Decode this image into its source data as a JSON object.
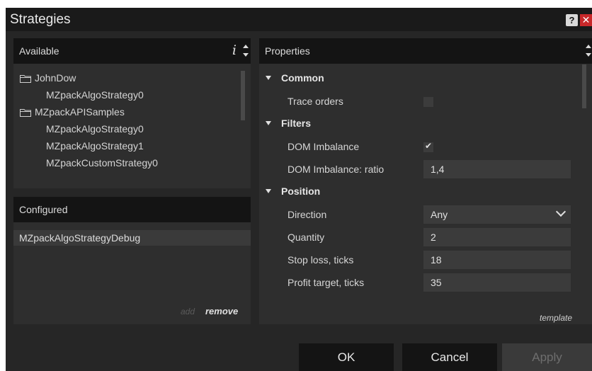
{
  "window": {
    "title": "Strategies",
    "help_label": "?",
    "close_label": "✕"
  },
  "available": {
    "header": "Available",
    "info_label": "i",
    "tree": [
      {
        "label": "JohnDow",
        "type": "folder"
      },
      {
        "label": "MZpackAlgoStrategy0",
        "type": "item"
      },
      {
        "label": "MZpackAPISamples",
        "type": "folder"
      },
      {
        "label": "MZpackAlgoStrategy0",
        "type": "item"
      },
      {
        "label": "MZpackAlgoStrategy1",
        "type": "item"
      },
      {
        "label": "MZpackCustomStrategy0",
        "type": "item"
      }
    ]
  },
  "configured": {
    "header": "Configured",
    "items": [
      "MZpackAlgoStrategyDebug"
    ],
    "add_label": "add",
    "remove_label": "remove"
  },
  "properties": {
    "header": "Properties",
    "categories": {
      "common": "Common",
      "filters": "Filters",
      "position": "Position"
    },
    "trace_orders": {
      "label": "Trace orders",
      "checked": false
    },
    "dom_imbalance": {
      "label": "DOM Imbalance",
      "checked": true,
      "check_glyph": "✔"
    },
    "dom_ratio": {
      "label": "DOM Imbalance: ratio",
      "value": "1,4"
    },
    "direction": {
      "label": "Direction",
      "value": "Any"
    },
    "quantity": {
      "label": "Quantity",
      "value": "2"
    },
    "stop_loss": {
      "label": "Stop loss, ticks",
      "value": "18"
    },
    "profit_target": {
      "label": "Profit target, ticks",
      "value": "35"
    },
    "template_label": "template"
  },
  "buttons": {
    "ok": "OK",
    "cancel": "Cancel",
    "apply": "Apply"
  },
  "colors": {
    "background": "#262626",
    "header": "#141414",
    "panel": "#2e2e2e",
    "field": "#3b3b3b",
    "close": "#c8282a"
  }
}
